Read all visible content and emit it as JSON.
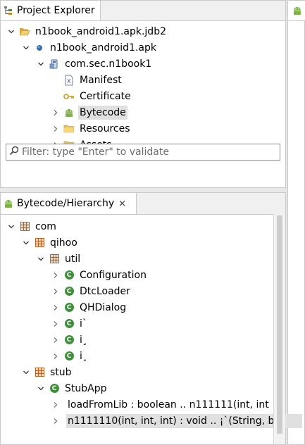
{
  "project_explorer": {
    "tab_label": "Project Explorer",
    "tree": [
      {
        "label": "n1book_android1.apk.jdb2",
        "expanded": true,
        "icon": "folder-open-icon",
        "depth": 0
      },
      {
        "label": "n1book_android1.apk",
        "expanded": true,
        "icon": "blue-dot-icon",
        "depth": 1
      },
      {
        "label": "com.sec.n1book1",
        "expanded": true,
        "icon": "package-icon",
        "depth": 2
      },
      {
        "label": "Manifest",
        "expanded": null,
        "icon": "manifest-xml-icon",
        "depth": 3
      },
      {
        "label": "Certificate",
        "expanded": null,
        "icon": "key-icon",
        "depth": 3
      },
      {
        "label": "Bytecode",
        "expanded": false,
        "icon": "android-icon",
        "depth": 3,
        "selected": true
      },
      {
        "label": "Resources",
        "expanded": false,
        "icon": "folder-icon",
        "depth": 3
      },
      {
        "label": "Assets",
        "expanded": false,
        "icon": "folder-icon",
        "depth": 3
      }
    ],
    "filter_placeholder": "Filter: type \"Enter\" to validate"
  },
  "hierarchy": {
    "tab_label": "Bytecode/Hierarchy",
    "close_label": "×",
    "tree": [
      {
        "label": "com",
        "expanded": true,
        "icon": "package-grid-icon",
        "depth": 0
      },
      {
        "label": "qihoo",
        "expanded": true,
        "icon": "package-grid-icon",
        "depth": 1
      },
      {
        "label": "util",
        "expanded": true,
        "icon": "package-grid-icon",
        "depth": 2
      },
      {
        "label": "Configuration",
        "expanded": false,
        "icon": "class-icon",
        "depth": 3
      },
      {
        "label": "DtcLoader",
        "expanded": false,
        "icon": "class-icon",
        "depth": 3
      },
      {
        "label": "QHDialog",
        "expanded": false,
        "icon": "class-icon",
        "depth": 3
      },
      {
        "label": "i`",
        "expanded": false,
        "icon": "class-icon",
        "depth": 3
      },
      {
        "label": "i¸",
        "expanded": false,
        "icon": "class-icon",
        "depth": 3
      },
      {
        "label": "i¸",
        "expanded": false,
        "icon": "class-icon",
        "depth": 3
      },
      {
        "label": "stub",
        "expanded": true,
        "icon": "package-grid-icon",
        "depth": 1
      },
      {
        "label": "StubApp",
        "expanded": true,
        "icon": "class-icon",
        "depth": 2
      },
      {
        "label": "loadFromLib : boolean .. n111111(int, int",
        "expanded": false,
        "icon": "none",
        "depth": 3
      },
      {
        "label": "n1111110(int, int, int) : void .. ¡`(String, b",
        "expanded": false,
        "icon": "none",
        "depth": 3,
        "selected": true
      }
    ]
  },
  "colors": {
    "class_green": "#3f8f3b",
    "package_brown": "#b5652b",
    "android_green": "#7cb342",
    "folder_yellow": "#e7c15a"
  }
}
